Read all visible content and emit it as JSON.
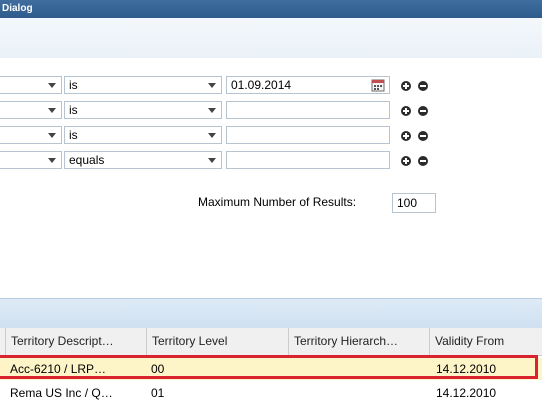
{
  "window": {
    "title": "Dialog"
  },
  "criteria": {
    "rows": [
      {
        "operator": "is",
        "value": "01.09.2014",
        "has_calendar": true
      },
      {
        "operator": "is",
        "value": ""
      },
      {
        "operator": "is",
        "value": ""
      },
      {
        "operator": "equals",
        "value": ""
      }
    ],
    "max_results_label": "Maximum Number of Results:",
    "max_results_value": "100"
  },
  "results": {
    "columns": [
      "Territory Descript…",
      "Territory Level",
      "Territory Hierarch…",
      "Validity From"
    ],
    "rows": [
      {
        "description": "Acc-6210 / LRP…",
        "level": "00",
        "hierarchy": "",
        "validity_from": "14.12.2010",
        "selected": true
      },
      {
        "description": "Rema US Inc / Q…",
        "level": "01",
        "hierarchy": "",
        "validity_from": "14.12.2010",
        "selected": false
      }
    ]
  },
  "colors": {
    "title_bar": "#2e5b8c",
    "selected_row": "#fdf5c8",
    "highlight_border": "#d9232f"
  }
}
